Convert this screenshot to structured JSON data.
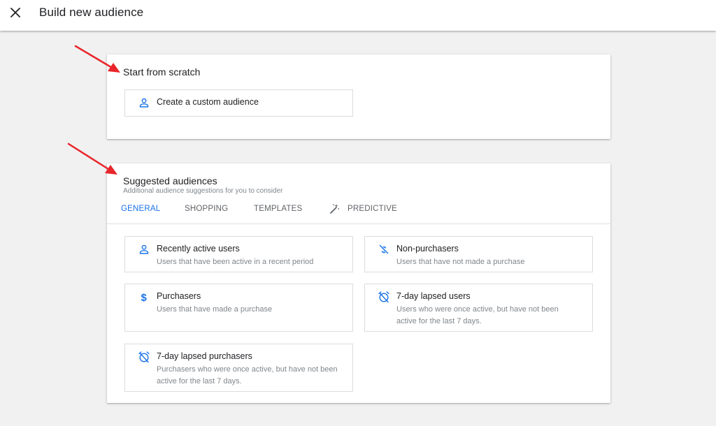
{
  "header": {
    "title": "Build new audience",
    "close_icon": "close-icon"
  },
  "scratch": {
    "title": "Start from scratch",
    "option": {
      "label": "Create a custom audience",
      "icon": "person-icon"
    }
  },
  "suggested": {
    "title": "Suggested audiences",
    "subtitle": "Additional audience suggestions for you to consider",
    "tabs": [
      {
        "label": "GENERAL",
        "active": true
      },
      {
        "label": "SHOPPING",
        "active": false
      },
      {
        "label": "TEMPLATES",
        "active": false
      },
      {
        "label": "PREDICTIVE",
        "active": false,
        "icon": "magic-wand-icon"
      }
    ],
    "options": [
      {
        "title": "Recently active users",
        "desc": "Users that have been active in a recent period",
        "icon": "person-icon"
      },
      {
        "title": "Non-purchasers",
        "desc": "Users that have not made a purchase",
        "icon": "no-dollar-icon"
      },
      {
        "title": "Purchasers",
        "desc": "Users that have made a purchase",
        "icon": "dollar-icon"
      },
      {
        "title": "7-day lapsed users",
        "desc": "Users who were once active, but have not been active for the last 7 days.",
        "icon": "alarm-off-icon"
      },
      {
        "title": "7-day lapsed purchasers",
        "desc": "Purchasers who were once active, but have not been active for the last 7 days.",
        "icon": "alarm-off-icon"
      }
    ]
  },
  "colors": {
    "accent": "#1a73e8",
    "arrow": "#e8262a",
    "border": "#dadce0",
    "muted_text": "#80868b"
  }
}
